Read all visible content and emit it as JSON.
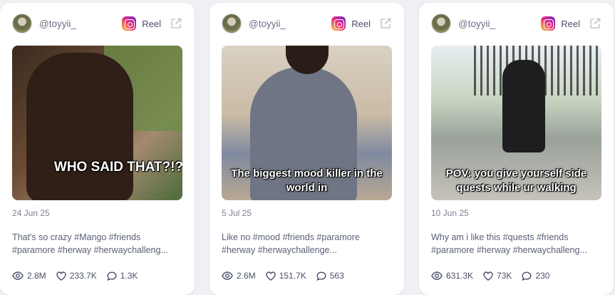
{
  "reel_label": "Reel",
  "cards": [
    {
      "handle": "@toyyii_",
      "overlay": "WHO SAID THAT?!?",
      "date": "24 Jun 25",
      "description": "That's so crazy #Mango #friends #paramore #herway #herwaychalleng...",
      "views": "2.8M",
      "likes": "233.7K",
      "comments": "1.3K"
    },
    {
      "handle": "@toyyii_",
      "overlay": "The biggest mood killer in the world in",
      "date": "5 Jul 25",
      "description": "Like no #mood #friends #paramore #herway #herwaychallenge...",
      "views": "2.6M",
      "likes": "151.7K",
      "comments": "563"
    },
    {
      "handle": "@toyyii_",
      "overlay": "POV: you give yourself side quests while ur walking",
      "date": "10 Jun 25",
      "description": "Why am i like this #quests #friends #paramore #herway #herwaychalleng...",
      "views": "631.3K",
      "likes": "73K",
      "comments": "230"
    }
  ],
  "icons": {
    "platform": "instagram-icon",
    "external": "external-link-icon",
    "views": "eye-icon",
    "likes": "heart-icon",
    "comments": "comment-icon"
  }
}
